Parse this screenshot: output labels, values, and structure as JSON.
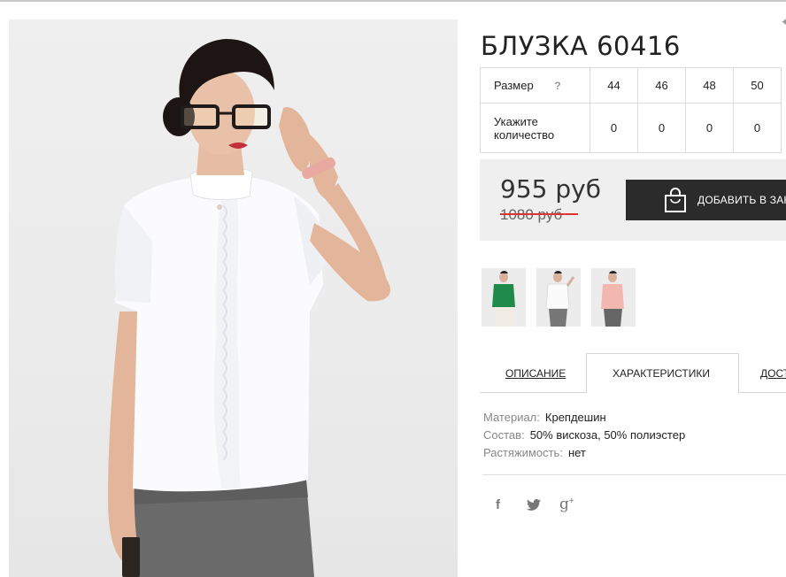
{
  "product": {
    "title": "БЛУЗКА 60416",
    "image_alt": "Женщина в белой блузке с рюшами и серой юбке"
  },
  "sizes": {
    "size_label": "Размер",
    "help": "?",
    "values": [
      "44",
      "46",
      "48",
      "50"
    ],
    "qty_label_line1": "Укажите",
    "qty_label_line2": "количество",
    "quantities": [
      "0",
      "0",
      "0",
      "0"
    ]
  },
  "price": {
    "current": "955 руб",
    "old": "1080 руб"
  },
  "cart": {
    "button_label": "ДОБАВИТЬ В ЗАКАЗ"
  },
  "thumbnails": [
    {
      "color": "green",
      "hex": "#1f8a4a"
    },
    {
      "color": "white",
      "hex": "#f4f4f4"
    },
    {
      "color": "pink",
      "hex": "#f2b8b0"
    }
  ],
  "tabs": {
    "description": "ОПИСАНИЕ",
    "characteristics": "ХАРАКТЕРИСТИКИ",
    "delivery": "ДОСТАВКА"
  },
  "specs": {
    "material_label": "Материал:",
    "material_value": "Крепдешин",
    "composition_label": "Состав:",
    "composition_value": "50% вискоза, 50% полиэстер",
    "stretch_label": "Растяжимость:",
    "stretch_value": "нет"
  },
  "social": {
    "facebook": "f",
    "twitter": "twitter-bird",
    "googleplus": "g+"
  },
  "colors": {
    "button_bg": "#2b2b2b",
    "price_box_bg": "#efefef",
    "old_price_strike": "#dd3333"
  }
}
